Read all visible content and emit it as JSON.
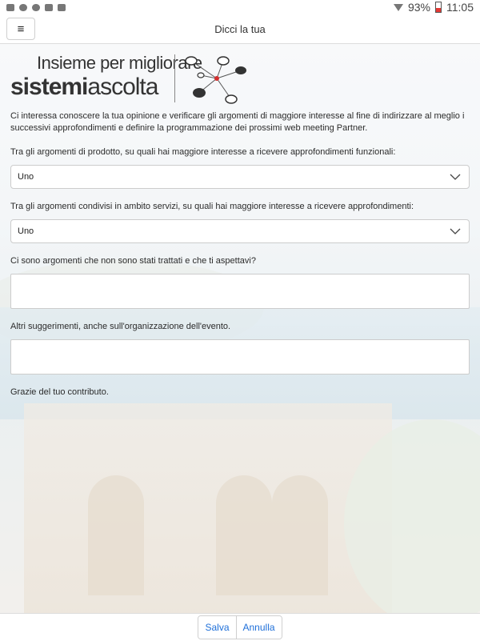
{
  "status_bar": {
    "battery_percent": "93%",
    "time": "11:05",
    "icons": [
      "photo-icon",
      "cloud-icon",
      "cloud-icon",
      "briefcase-icon",
      "briefcase-icon"
    ]
  },
  "header": {
    "title": "Dicci la tua",
    "menu_icon": "hamburger-menu-icon"
  },
  "logo": {
    "line1": "Insieme per migliorare",
    "line2_bold": "sistemi",
    "line2_regular": "ascolta"
  },
  "intro_text": "Ci interessa conoscere la tua opinione e verificare gli argomenti di maggiore interesse al fine di indirizzare al meglio i successivi approfondimenti e definire la programmazione dei prossimi web meeting Partner.",
  "questions": [
    {
      "label": "Tra gli argomenti di prodotto, su quali hai maggiore interesse a ricevere approfondimenti funzionali:",
      "type": "select",
      "value": "Uno"
    },
    {
      "label": "Tra gli argomenti condivisi in ambito servizi, su quali hai maggiore interesse a ricevere approfondimenti:",
      "type": "select",
      "value": "Uno"
    },
    {
      "label": "Ci sono argomenti che non sono stati trattati e che ti aspettavi?",
      "type": "text",
      "value": ""
    },
    {
      "label": "Altri suggerimenti, anche sull'organizzazione dell'evento.",
      "type": "text",
      "value": ""
    }
  ],
  "thanks_text": "Grazie del tuo contributo.",
  "footer": {
    "save_label": "Salva",
    "cancel_label": "Annulla"
  },
  "colors": {
    "accent": "#1e6fd9",
    "battery_low": "#e53935"
  }
}
